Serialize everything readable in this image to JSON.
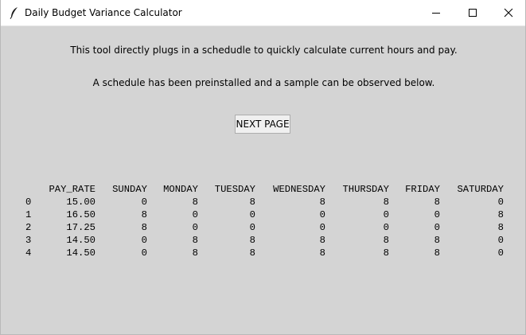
{
  "window": {
    "title": "Daily Budget Variance Calculator"
  },
  "intro": {
    "line1": "This tool directly plugs in a schedudle to quickly calculate current hours and pay.",
    "line2": "A schedule has been preinstalled and a sample can be observed below."
  },
  "buttons": {
    "next_page": "NEXT PAGE"
  },
  "table": {
    "columns": [
      "PAY_RATE",
      "SUNDAY",
      "MONDAY",
      "TUESDAY",
      "WEDNESDAY",
      "THURSDAY",
      "FRIDAY",
      "SATURDAY"
    ],
    "index": [
      "0",
      "1",
      "2",
      "3",
      "4"
    ],
    "rows": [
      [
        "15.00",
        "0",
        "8",
        "8",
        "8",
        "8",
        "8",
        "0"
      ],
      [
        "16.50",
        "8",
        "0",
        "0",
        "0",
        "0",
        "0",
        "8"
      ],
      [
        "17.25",
        "8",
        "0",
        "0",
        "0",
        "0",
        "0",
        "8"
      ],
      [
        "14.50",
        "0",
        "8",
        "8",
        "8",
        "8",
        "8",
        "0"
      ],
      [
        "14.50",
        "0",
        "8",
        "8",
        "8",
        "8",
        "8",
        "0"
      ]
    ]
  },
  "icons": {
    "app": "feather-icon",
    "minimize": "minimize-icon",
    "maximize": "maximize-icon",
    "close": "close-icon"
  }
}
